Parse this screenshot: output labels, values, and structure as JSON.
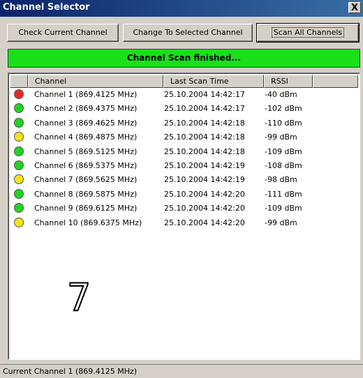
{
  "window": {
    "title": "Channel Selector",
    "close_label": "X"
  },
  "toolbar": {
    "check_label": "Check Current Channel",
    "change_label": "Change To Selected Channel",
    "scan_label": "Scan All Channels"
  },
  "status_banner": {
    "text": "Channel Scan finished...",
    "color": "#19e019"
  },
  "list": {
    "headers": [
      "",
      "Channel",
      "Last Scan Time",
      "RSSI",
      ""
    ],
    "rows": [
      {
        "status": "red",
        "channel": "Channel 1 (869.4125 MHz)",
        "time": "25.10.2004 14:42:17",
        "rssi": "-40 dBm"
      },
      {
        "status": "green",
        "channel": "Channel 2 (869.4375 MHz)",
        "time": "25.10.2004 14:42:17",
        "rssi": "-102 dBm"
      },
      {
        "status": "green",
        "channel": "Channel 3 (869.4625 MHz)",
        "time": "25.10.2004 14:42:18",
        "rssi": "-110 dBm"
      },
      {
        "status": "yellow",
        "channel": "Channel 4 (869.4875 MHz)",
        "time": "25.10.2004 14:42:18",
        "rssi": "-99 dBm"
      },
      {
        "status": "green",
        "channel": "Channel 5 (869.5125 MHz)",
        "time": "25.10.2004 14:42:18",
        "rssi": "-109 dBm"
      },
      {
        "status": "green",
        "channel": "Channel 6 (869.5375 MHz)",
        "time": "25.10.2004 14:42:19",
        "rssi": "-108 dBm"
      },
      {
        "status": "yellow",
        "channel": "Channel 7 (869.5625 MHz)",
        "time": "25.10.2004 14:42:19",
        "rssi": "-98 dBm"
      },
      {
        "status": "green",
        "channel": "Channel 8 (869.5875 MHz)",
        "time": "25.10.2004 14:42:20",
        "rssi": "-111 dBm"
      },
      {
        "status": "green",
        "channel": "Channel 9 (869.6125 MHz)",
        "time": "25.10.2004 14:42:20",
        "rssi": "-109 dBm"
      },
      {
        "status": "yellow",
        "channel": "Channel 10 (869.6375 MHz)",
        "time": "25.10.2004 14:42:20",
        "rssi": "-99 dBm"
      }
    ],
    "status_colors": {
      "red": "#e8281e",
      "green": "#1fd51f",
      "yellow": "#f5e31a"
    }
  },
  "annotation": {
    "number": "7"
  },
  "statusbar": {
    "text": "Current Channel 1 (869.4125 MHz)"
  }
}
